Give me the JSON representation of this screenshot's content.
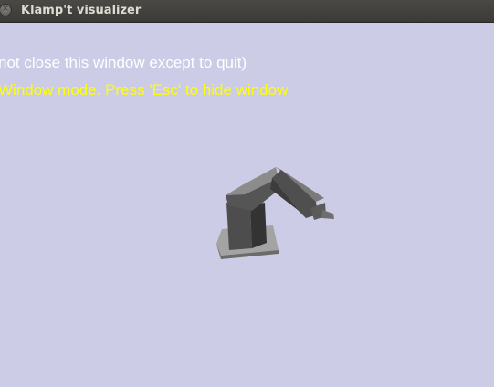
{
  "window": {
    "title": "Klamp't visualizer",
    "close_glyph": "×"
  },
  "overlay": {
    "line1": "not close this window except to quit)",
    "line2": "Window mode. Press 'Esc' to hide window",
    "line1_color": "#ffffff",
    "line2_color": "#ffff00"
  },
  "viewport": {
    "background": "#cccce6"
  },
  "scene": {
    "object": "robot-arm-model",
    "base_color": "#a3a3a3",
    "body_color": "#4d4d4d"
  }
}
